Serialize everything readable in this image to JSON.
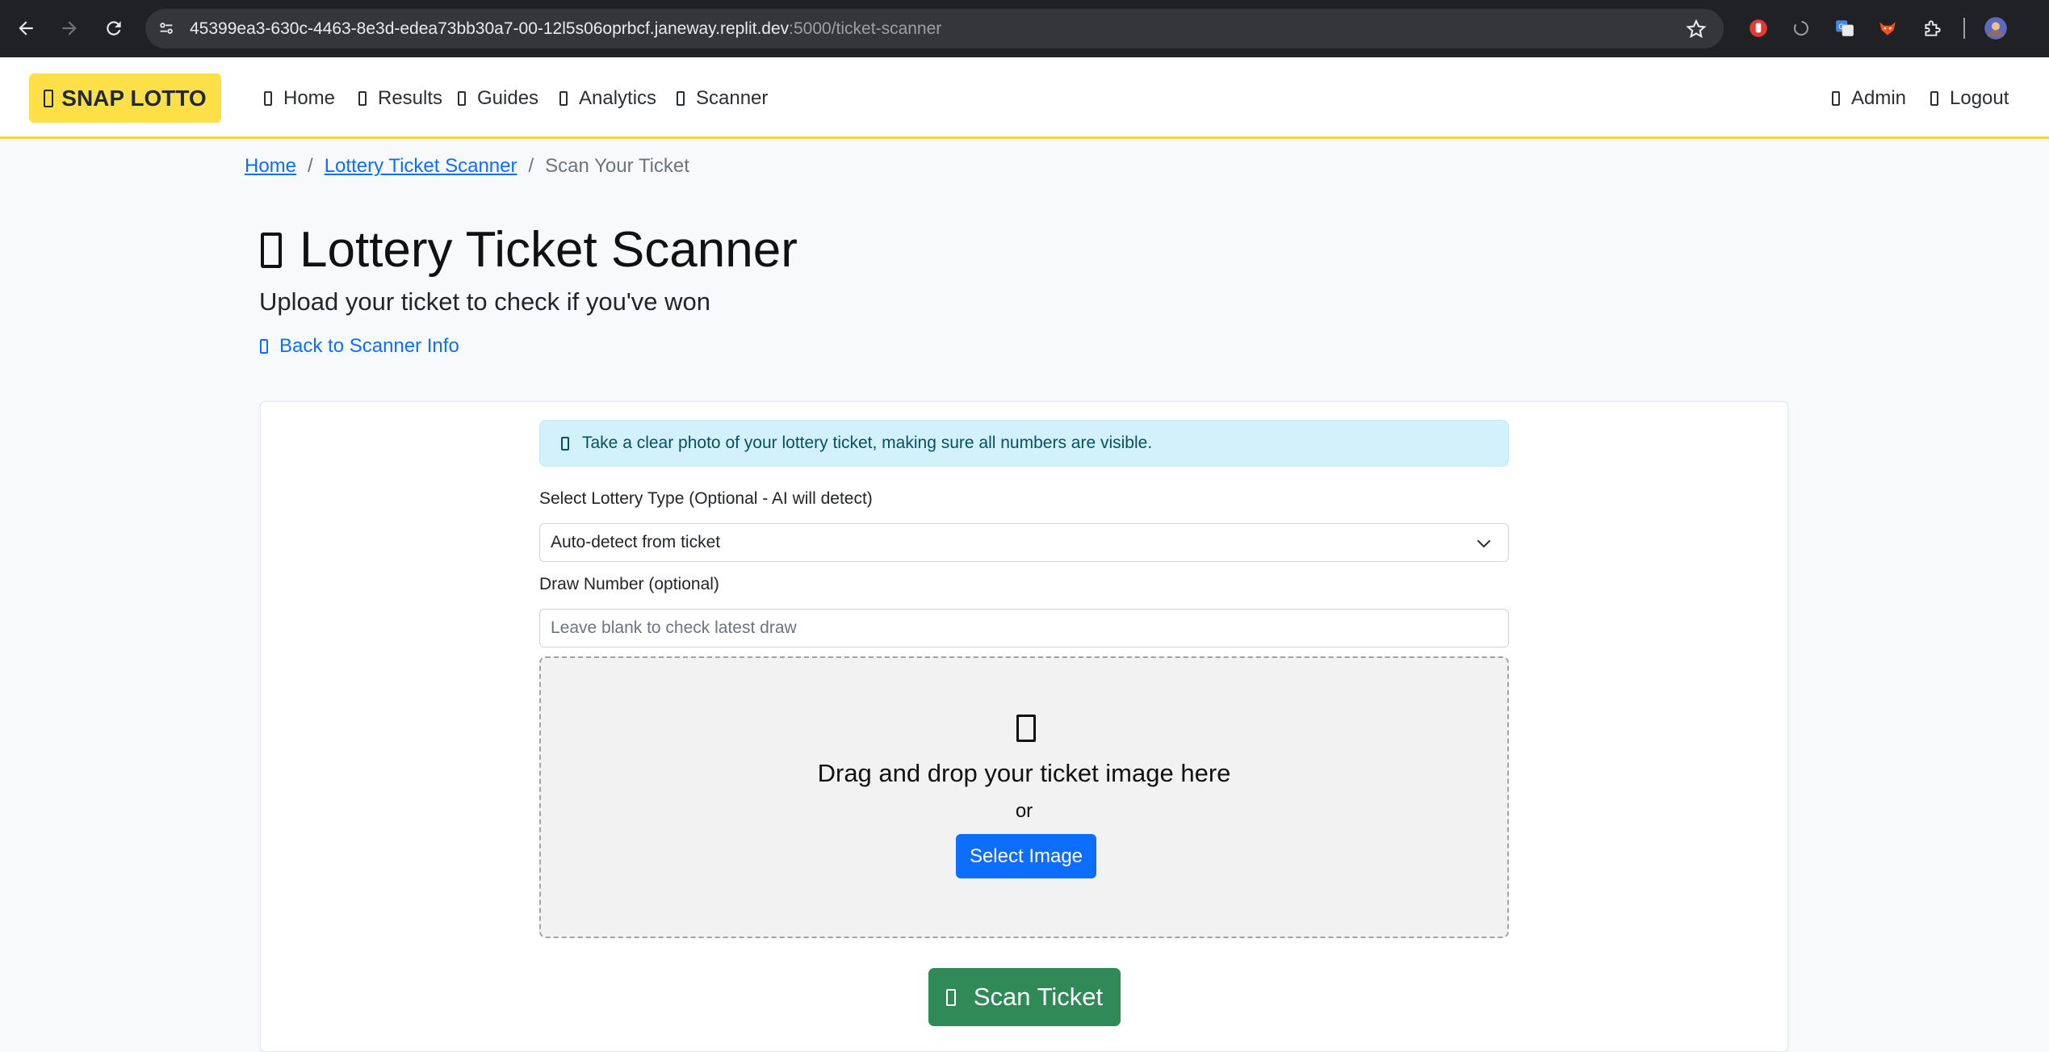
{
  "browser": {
    "url_host": "45399ea3-630c-4463-8e3d-edea73bb30a7-00-12l5s06oprbcf.janeway.replit.dev",
    "url_path": ":5000/ticket-scanner"
  },
  "navbar": {
    "brand": "SNAP LOTTO",
    "links": [
      {
        "label": "Home",
        "icon": "home-icon"
      },
      {
        "label": "Results",
        "icon": "results-icon"
      },
      {
        "label": "Guides",
        "icon": "guides-icon"
      },
      {
        "label": "Analytics",
        "icon": "analytics-icon"
      },
      {
        "label": "Scanner",
        "icon": "scanner-icon"
      }
    ],
    "right_links": [
      {
        "label": "Admin",
        "icon": "admin-icon"
      },
      {
        "label": "Logout",
        "icon": "logout-icon"
      }
    ]
  },
  "breadcrumb": {
    "home": "Home",
    "scanner": "Lottery Ticket Scanner",
    "current": "Scan Your Ticket",
    "separator": "/"
  },
  "header": {
    "title": "Lottery Ticket Scanner",
    "subtitle": "Upload your ticket to check if you've won",
    "back_link": "Back to Scanner Info"
  },
  "form": {
    "alert": "Take a clear photo of your lottery ticket, making sure all numbers are visible.",
    "lottery_type_label": "Select Lottery Type (Optional - AI will detect)",
    "lottery_type_value": "Auto-detect from ticket",
    "draw_number_label": "Draw Number (optional)",
    "draw_number_placeholder": "Leave blank to check latest draw",
    "draw_number_value": "",
    "dropzone_text": "Drag and drop your ticket image here",
    "dropzone_or": "or",
    "select_image_button": "Select Image",
    "scan_button": "Scan Ticket"
  },
  "colors": {
    "brand_bg": "#fde047",
    "primary": "#0d6efd",
    "success": "#2f8a57",
    "alert_bg": "#d3f1fa"
  }
}
